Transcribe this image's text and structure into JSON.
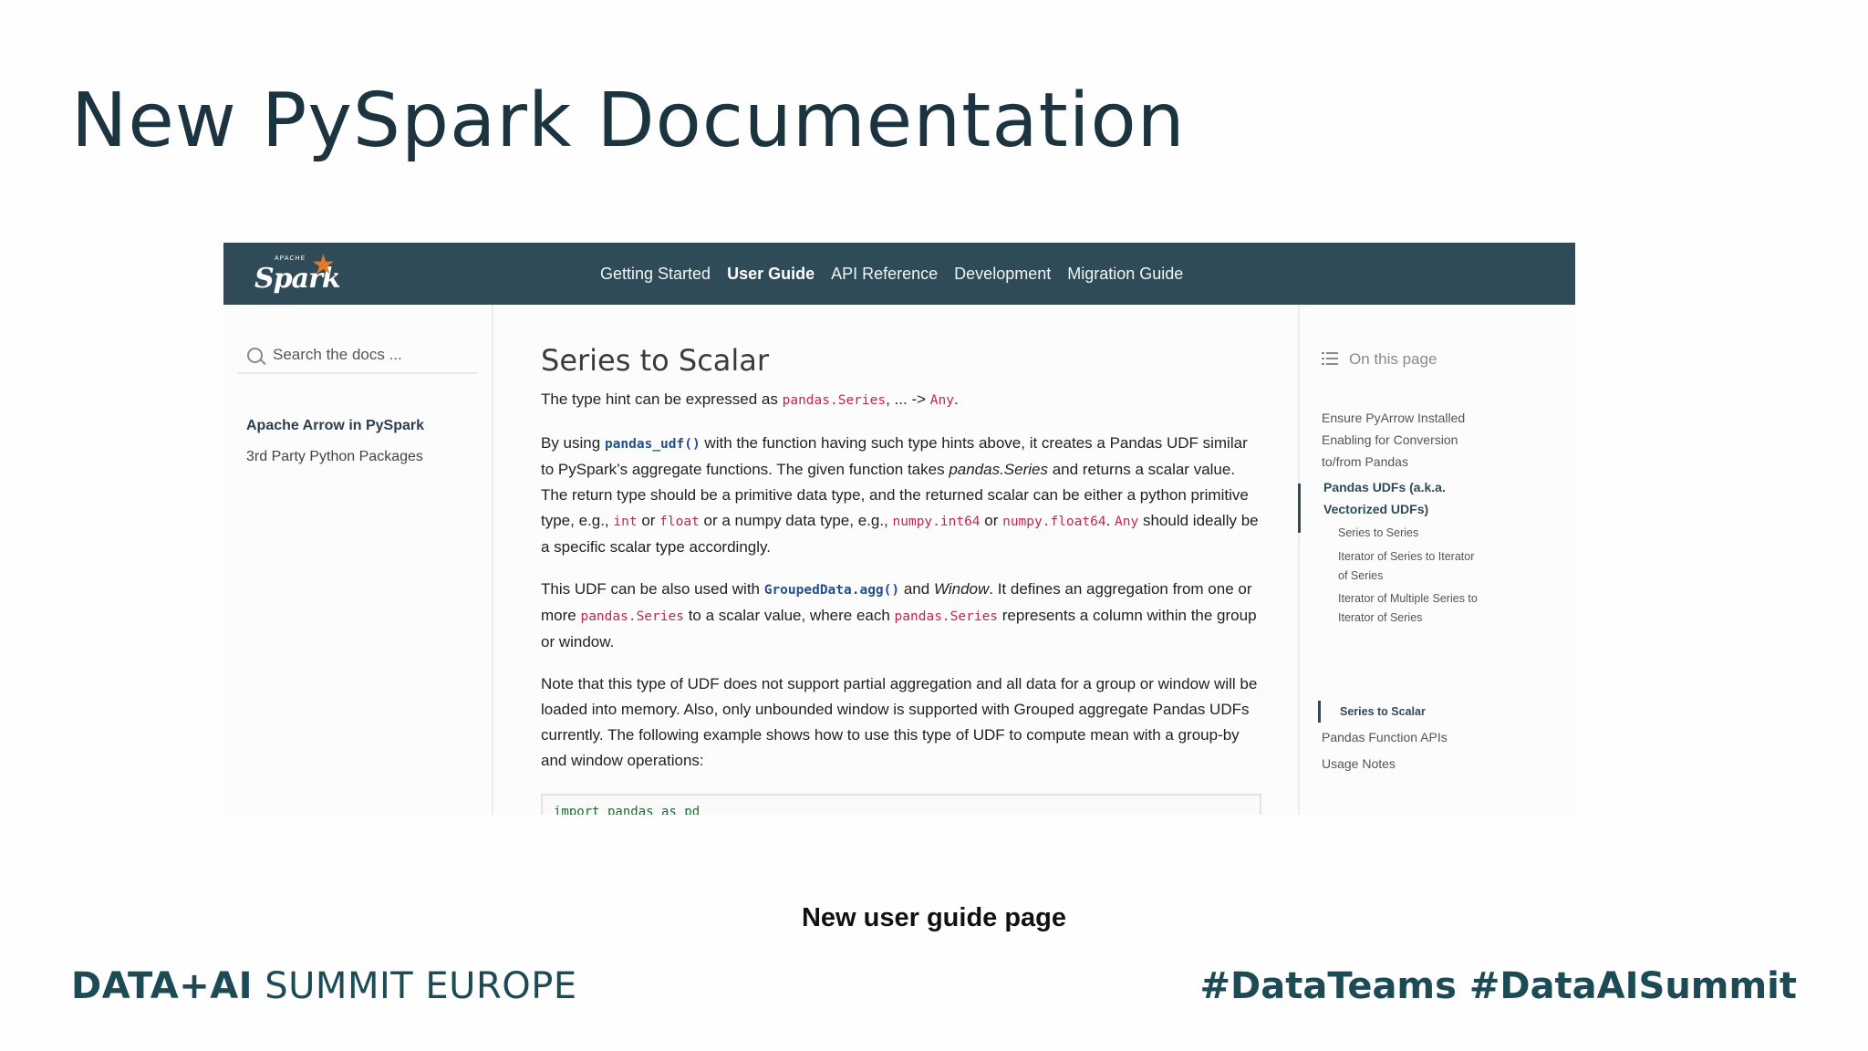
{
  "slide": {
    "title": "New PySpark Documentation",
    "caption": "New user guide page",
    "footer_brand_bold": "DATA+AI",
    "footer_brand_rest": " SUMMIT EUROPE",
    "footer_hashtags": "#DataTeams  #DataAISummit"
  },
  "logo": {
    "apache": "APACHE",
    "text": "Spark",
    "star": "★"
  },
  "nav": {
    "links": [
      "Getting Started",
      "User Guide",
      "API Reference",
      "Development",
      "Migration Guide"
    ],
    "active": "User Guide"
  },
  "sidebar": {
    "search_placeholder": "Search the docs ...",
    "items": [
      "Apache Arrow in PySpark",
      "3rd Party Python Packages"
    ]
  },
  "content": {
    "heading": "Series to Scalar",
    "p1": {
      "a": "The type hint can be expressed as ",
      "code1": "pandas.Series",
      "b": ", ... -> ",
      "code2": "Any",
      "c": "."
    },
    "p2": {
      "a": "By using ",
      "code1": "pandas_udf()",
      "b": " with the function having such type hints above, it creates a Pandas UDF similar to PySpark’s aggregate functions. The given function takes ",
      "em1": "pandas.Series",
      "c": " and returns a scalar value. The return type should be a primitive data type, and the returned scalar can be either a python primitive type, e.g., ",
      "code2": "int",
      "d": " or ",
      "code3": "float",
      "e": " or a numpy data type, e.g., ",
      "code4": "numpy.int64",
      "f": " or ",
      "code5": "numpy.float64",
      "g": ". ",
      "code6": "Any",
      "h": " should ideally be a specific scalar type accordingly."
    },
    "p3": {
      "a": "This UDF can be also used with ",
      "code1": "GroupedData.agg()",
      "b": " and ",
      "em1": "Window",
      "c": ". It defines an aggregation from one or more ",
      "code2": "pandas.Series",
      "d": " to a scalar value, where each ",
      "code3": "pandas.Series",
      "e": " represents a column within the group or window."
    },
    "p4": "Note that this type of UDF does not support partial aggregation and all data for a group or window will be loaded into memory. Also, only unbounded window is supported with Grouped aggregate Pandas UDFs currently. The following example shows how to use this type of UDF to compute mean with a group-by and window operations:",
    "code_line": "import pandas as pd"
  },
  "toc": {
    "header": "On this page",
    "items": [
      {
        "label": "Ensure PyArrow Installed"
      },
      {
        "label": "Enabling for Conversion"
      },
      {
        "label": "to/from Pandas"
      },
      {
        "label": "Pandas UDFs (a.k.a."
      },
      {
        "label": "Vectorized UDFs)"
      },
      {
        "label": "Series to Series"
      },
      {
        "label": "Iterator of Series to Iterator"
      },
      {
        "label": "of Series"
      },
      {
        "label": "Iterator of Multiple Series to"
      },
      {
        "label": "Iterator of Series"
      },
      {
        "label": "Series to Scalar"
      },
      {
        "label": "Pandas Function APIs"
      },
      {
        "label": "Usage Notes"
      }
    ]
  }
}
